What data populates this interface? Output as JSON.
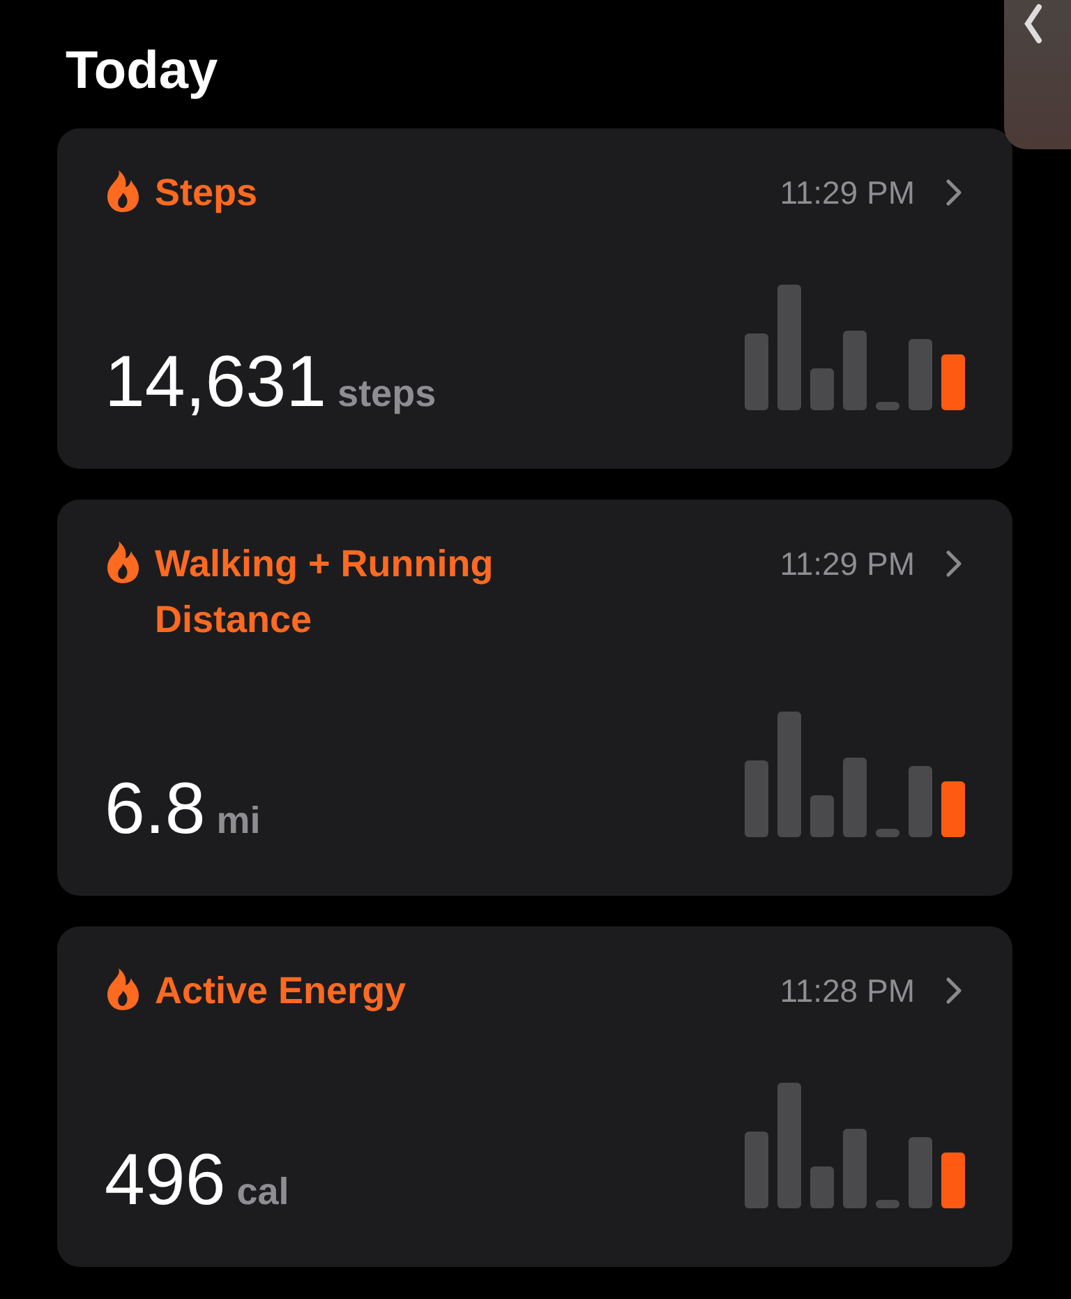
{
  "heading": "Today",
  "cards": [
    {
      "title": "Steps",
      "time": "11:29 PM",
      "value": "14,631",
      "unit": "steps"
    },
    {
      "title": "Walking + Running Distance",
      "time": "11:29 PM",
      "value": "6.8",
      "unit": "mi"
    },
    {
      "title": "Active Energy",
      "time": "11:28 PM",
      "value": "496",
      "unit": "cal"
    }
  ]
}
